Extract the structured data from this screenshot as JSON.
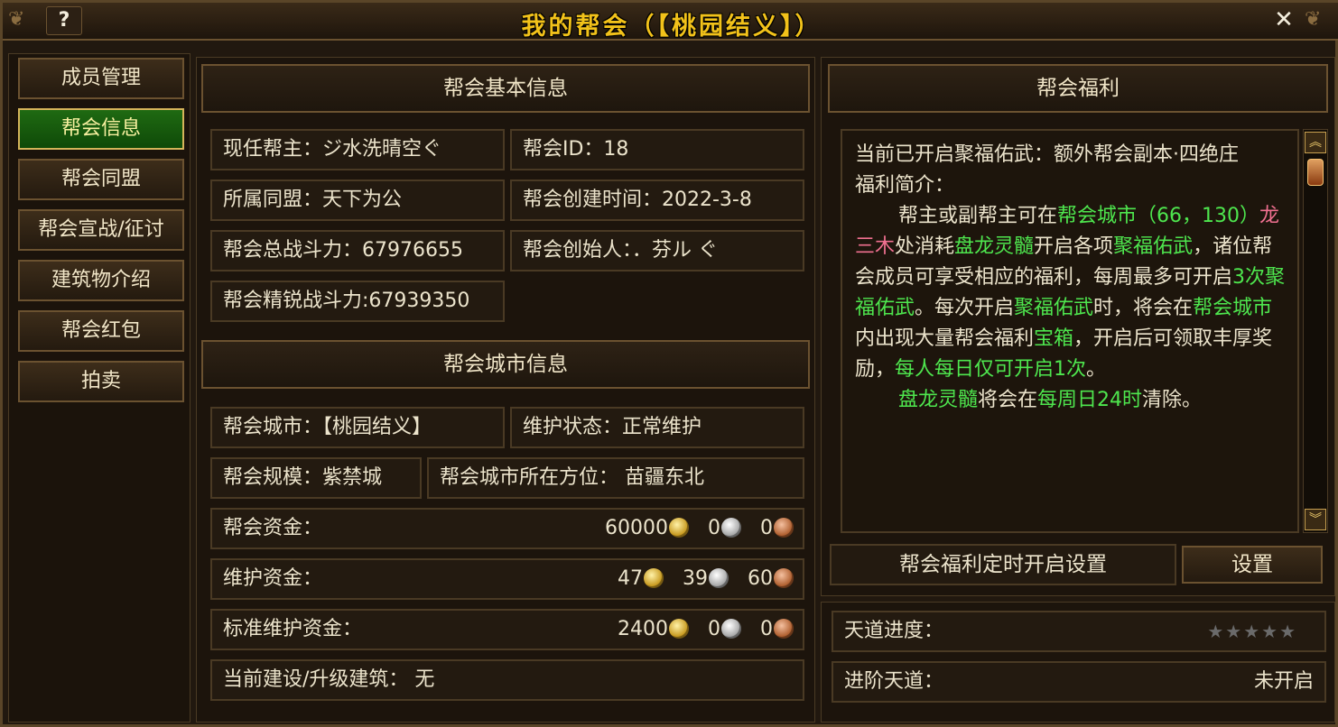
{
  "window": {
    "title": "我的帮会（【桃园结义】）",
    "help": "?",
    "close": "✕"
  },
  "nav": [
    {
      "label": "成员管理",
      "active": false
    },
    {
      "label": "帮会信息",
      "active": true
    },
    {
      "label": "帮会同盟",
      "active": false
    },
    {
      "label": "帮会宣战/征讨",
      "active": false
    },
    {
      "label": "建筑物介绍",
      "active": false
    },
    {
      "label": "帮会红包",
      "active": false
    },
    {
      "label": "拍卖",
      "active": false
    }
  ],
  "basic": {
    "header": "帮会基本信息",
    "leader": "现任帮主：ジ水洗晴空ぐ",
    "guild_id": "帮会ID：18",
    "alliance": "所属同盟：天下为公",
    "created": "帮会创建时间：2022-3-8",
    "total_power": "帮会总战斗力：67976655",
    "founder": "帮会创始人：．芬ル ぐ",
    "elite_power": "帮会精锐战斗力:67939350"
  },
  "city": {
    "header": "帮会城市信息",
    "city": "帮会城市：【桃园结义】",
    "maintain_status": "维护状态：正常维护",
    "scale": "帮会规模：紫禁城",
    "location": "帮会城市所在方位： 苗疆东北",
    "funds_label": "帮会资金：",
    "funds": {
      "gold": "60000",
      "silver": "0",
      "copper": "0"
    },
    "maint_label": "维护资金：",
    "maint": {
      "gold": "47",
      "silver": "39",
      "copper": "60"
    },
    "std_label": "标准维护资金：",
    "std": {
      "gold": "2400",
      "silver": "0",
      "copper": "0"
    },
    "building": "当前建设/升级建筑： 无"
  },
  "welfare": {
    "header": "帮会福利",
    "line1": "当前已开启聚福佑武：额外帮会副本·四绝庄",
    "line2": "福利简介：",
    "p1_a": "帮主或副帮主可在",
    "p1_city": "帮会城市（66，130）",
    "p1_npc": "龙三木",
    "p1_b": "处消耗",
    "p1_item": "盘龙灵髓",
    "p1_c": "开启各项",
    "p1_jf": "聚福佑武",
    "p1_d": "，诸位帮会成员可享受相应的福利，每周最多可开启",
    "p1_times": "3次聚福佑武",
    "p1_e": "。每次开启",
    "p1_jf2": "聚福佑武",
    "p1_f": "时，将会在",
    "p1_city2": "帮会城市",
    "p1_g": "内出现大量帮会福利",
    "p1_box": "宝箱",
    "p1_h": "，开启后可领取丰厚奖励，",
    "p1_once": "每人每日仅可开启1次",
    "p1_i": "。",
    "p2_item": "盘龙灵髓",
    "p2_a": "将会在",
    "p2_time": "每周日24时",
    "p2_b": "清除。",
    "timer_label": "帮会福利定时开启设置",
    "set_button": "设置"
  },
  "tiandao": {
    "progress_label": "天道进度：",
    "stars_filled": 0,
    "stars_total": 5,
    "advance_label": "进阶天道：",
    "advance_status": "未开启"
  }
}
